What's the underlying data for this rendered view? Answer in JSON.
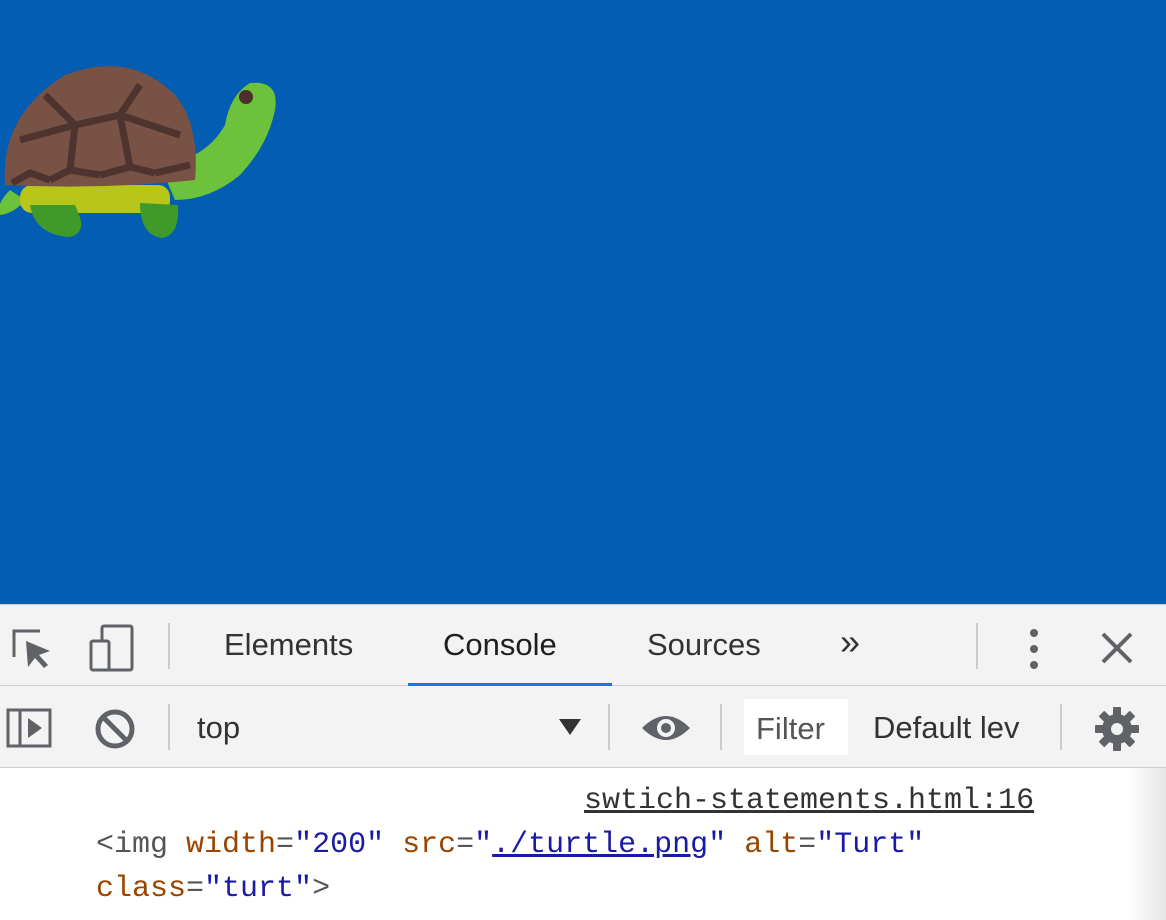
{
  "devtools": {
    "tabs": [
      {
        "label": "Elements",
        "active": false
      },
      {
        "label": "Console",
        "active": true
      },
      {
        "label": "Sources",
        "active": false
      }
    ],
    "more_tabs_label": "»",
    "context_selector": {
      "value": "top"
    },
    "filter": {
      "placeholder": "Filter"
    },
    "levels": {
      "label": "Default lev"
    }
  },
  "console": {
    "source_link": "swtich-statements.html:16",
    "entry": {
      "tag_open": "<img",
      "attr1_name": "width",
      "attr1_value": "\"200\"",
      "attr2_name": "src",
      "attr2_quote_open": "\"",
      "attr2_link": "./turtle.png",
      "attr2_quote_close": "\"",
      "attr3_name": "alt",
      "attr3_value": "\"Turt\"",
      "attr4_name": "class",
      "attr4_value": "\"turt\"",
      "equals": "=",
      "tag_close": ">"
    }
  },
  "colors": {
    "page_background": "#025db3",
    "devtools_bar": "#f3f3f3",
    "active_tab_underline": "#1a73e8",
    "attr_name": "#994500",
    "attr_value": "#1a1aa6"
  },
  "icons": {
    "inspect": "inspect-element-icon",
    "device": "device-toolbar-icon",
    "more": "more-vertical-icon",
    "close": "close-icon",
    "sidebar": "show-sidebar-icon",
    "clear": "clear-console-icon",
    "dropdown": "dropdown-arrow-icon",
    "live_expression": "eye-icon",
    "settings": "gear-icon",
    "turtle": "turtle-image"
  }
}
